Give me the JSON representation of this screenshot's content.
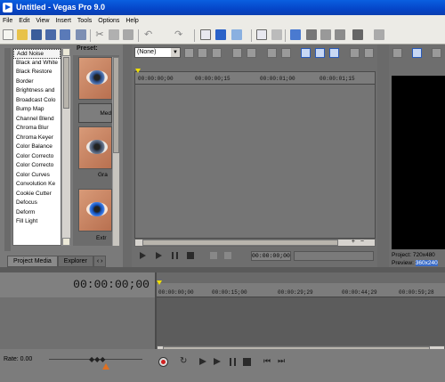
{
  "window": {
    "title": "Untitled - Vegas Pro 9.0"
  },
  "menu": [
    "File",
    "Edit",
    "View",
    "Insert",
    "Tools",
    "Options",
    "Help"
  ],
  "fx": {
    "items": [
      "Add Noise",
      "Black and White",
      "Black Restore",
      "Border",
      "Brightness and",
      "Broadcast Colo",
      "Bump Map",
      "Channel Blend",
      "Chroma Blur",
      "Chroma Keyer",
      "Color Balance",
      "Color Correcto",
      "Color Correcto",
      "Color Curves",
      "Convolution Ke",
      "Cookie Cutter",
      "Defocus",
      "Deform",
      "Fill Light"
    ],
    "preset_label": "Preset:",
    "presets": [
      "Med",
      "Gra",
      "Extr"
    ],
    "tabs": [
      "Project Media",
      "Explorer"
    ]
  },
  "trimmer": {
    "dropdown": "(None)",
    "ruler": [
      "00:00:00;00",
      "00:00:00;15",
      "00:00:01;00",
      "00:00:01;15"
    ],
    "timecode": "00:00:00;00"
  },
  "preview": {
    "project_label": "Project:",
    "project_value": "720x480",
    "preview_label": "Preview:",
    "preview_value": "360x240"
  },
  "timeline": {
    "timecode": "00:00:00;00",
    "ruler": [
      "00:00:00;00",
      "00:00:15;00",
      "00:00:29;29",
      "00:00:44;29",
      "00:00:59;28"
    ],
    "rate": "Rate: 0.00"
  },
  "colors": {
    "accent": "#0a55d8",
    "record": "#d02020"
  }
}
